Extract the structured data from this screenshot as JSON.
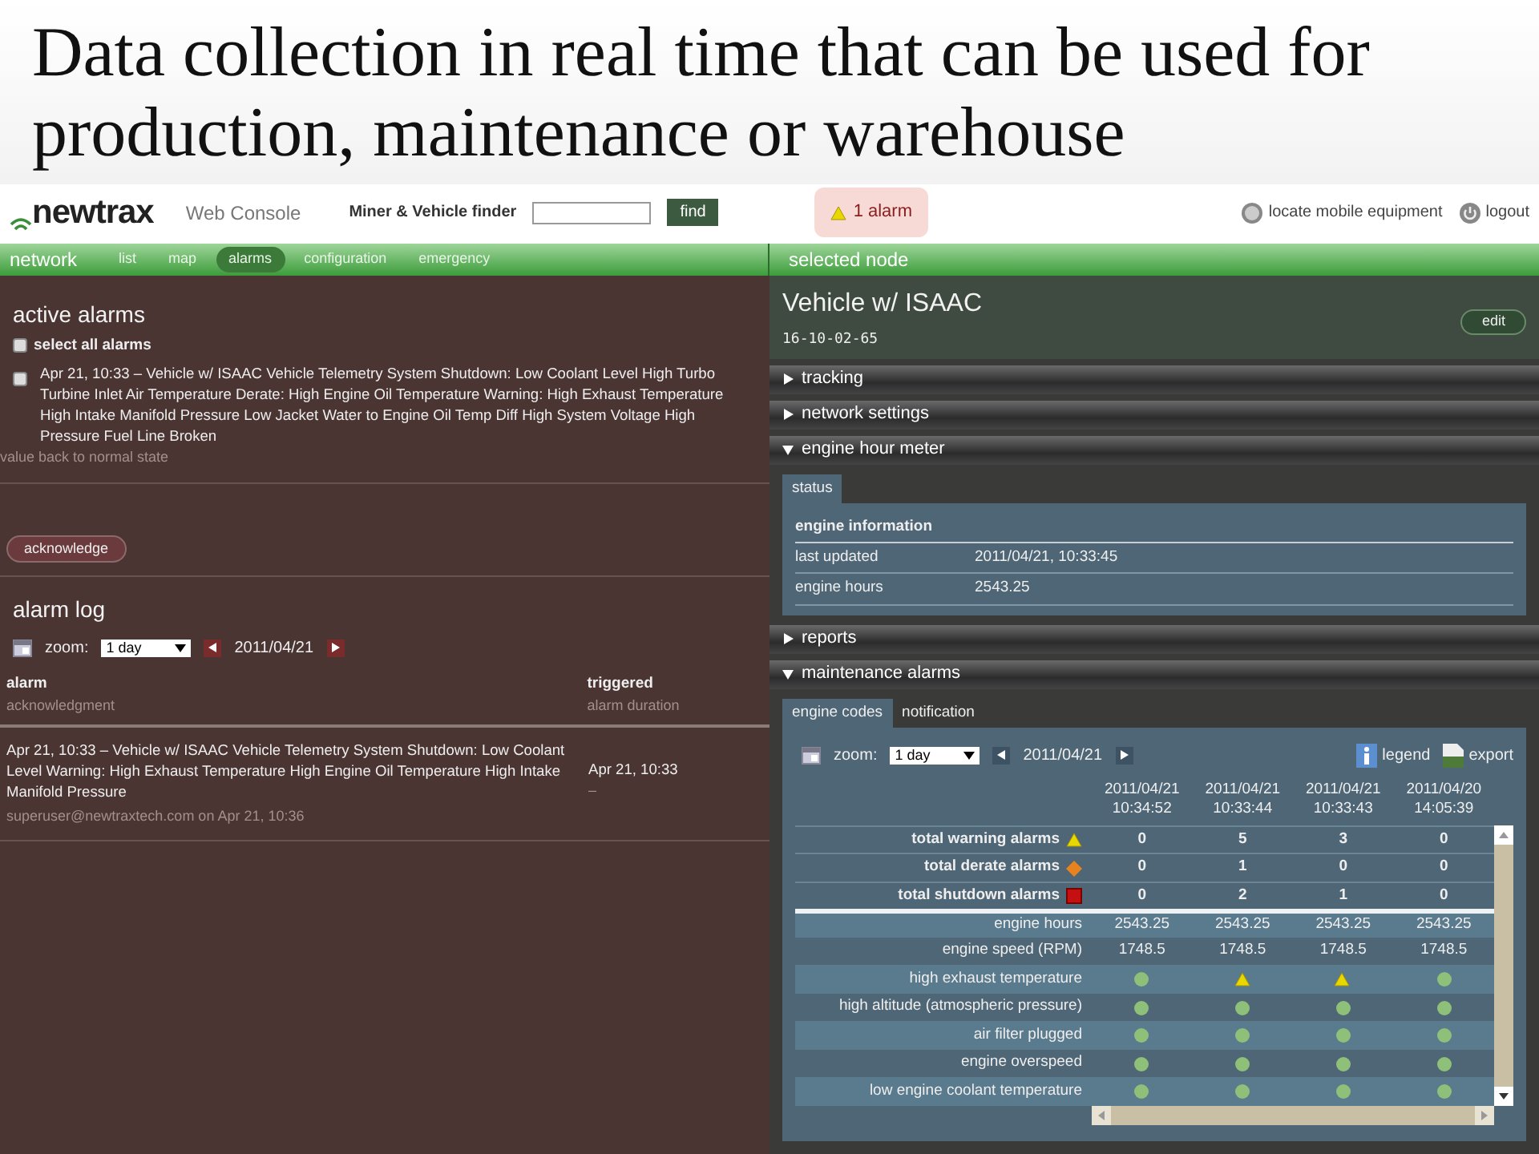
{
  "slide_title": "Data collection in real time that can be used for production, maintenance or warehouse",
  "header": {
    "logo": "newtrax",
    "app_name": "Web Console",
    "finder_label": "Miner & Vehicle finder",
    "find_button": "find",
    "alarm_badge": "1 alarm",
    "links": [
      {
        "label": "locate mobile equipment",
        "kind": "locate"
      },
      {
        "label": "logout",
        "kind": "logout"
      }
    ]
  },
  "nav": {
    "title": "network",
    "items": [
      {
        "label": "list",
        "selected": false
      },
      {
        "label": "map",
        "selected": false
      },
      {
        "label": "alarms",
        "selected": true
      },
      {
        "label": "configuration",
        "selected": false
      },
      {
        "label": "emergency",
        "selected": false
      }
    ],
    "right_title": "selected node"
  },
  "active_alarms": {
    "title": "active alarms",
    "select_all": {
      "label": "select all alarms",
      "checked": false
    },
    "alarms": [
      {
        "text": "Apr 21, 10:33 – Vehicle w/ ISAAC Vehicle Telemetry System Shutdown: Low Coolant Level High Turbo Turbine Inlet Air Temperature Derate: High Engine Oil Temperature Warning: High Exhaust Temperature High Intake Manifold Pressure Low Jacket Water to Engine Oil Temp Diff High System Voltage High Pressure Fuel Line Broken",
        "checked": false
      }
    ],
    "hint": "value back to normal state",
    "button": "acknowledge"
  },
  "alarm_log": {
    "title": "alarm log",
    "zoom_label": "zoom:",
    "zoom_value": "1 day",
    "date": "2011/04/21",
    "columns": [
      {
        "title": "alarm",
        "subtitle": "acknowledgment"
      },
      {
        "title": "triggered",
        "subtitle": "alarm duration"
      }
    ],
    "rows": [
      {
        "alarm": "Apr 21, 10:33 – Vehicle w/ ISAAC Vehicle Telemetry System Shutdown: Low Coolant Level Warning: High Exhaust Temperature High Engine Oil Temperature High Intake Manifold Pressure",
        "acknowledgment": "superuser@newtraxtech.com on Apr 21, 10:36",
        "triggered": "Apr 21, 10:33",
        "duration": "–"
      }
    ]
  },
  "node": {
    "title": "Vehicle w/ ISAAC",
    "id": "16-10-02-65",
    "edit_button": "edit",
    "sections": [
      {
        "label": "tracking",
        "expanded": false
      },
      {
        "label": "network settings",
        "expanded": false
      },
      {
        "label": "engine hour meter",
        "expanded": true,
        "content": {
          "kind": "info",
          "tabs": [
            {
              "label": "status",
              "selected": true
            }
          ],
          "heading": "engine information",
          "rows": [
            {
              "label": "last updated",
              "value": "2011/04/21, 10:33:45"
            },
            {
              "label": "engine hours",
              "value": "2543.25"
            }
          ]
        }
      },
      {
        "label": "reports",
        "expanded": false
      },
      {
        "label": "maintenance alarms",
        "expanded": true,
        "content": {
          "kind": "grid",
          "tabs": [
            {
              "label": "engine codes",
              "selected": true
            },
            {
              "label": "notification",
              "selected": false
            }
          ],
          "zoom_label": "zoom:",
          "zoom_value": "1 day",
          "date": "2011/04/21",
          "legend": "legend",
          "export": "export",
          "columns": [
            {
              "date": "2011/04/21",
              "time": "10:34:52"
            },
            {
              "date": "2011/04/21",
              "time": "10:33:44"
            },
            {
              "date": "2011/04/21",
              "time": "10:33:43"
            },
            {
              "date": "2011/04/20",
              "time": "14:05:39"
            }
          ],
          "summary": [
            {
              "label": "total warning alarms",
              "kind": "warning",
              "values": [
                "0",
                "5",
                "3",
                "0"
              ]
            },
            {
              "label": "total derate alarms",
              "kind": "derate",
              "values": [
                "0",
                "1",
                "0",
                "0"
              ]
            },
            {
              "label": "total shutdown alarms",
              "kind": "shutdown",
              "values": [
                "0",
                "2",
                "1",
                "0"
              ]
            }
          ],
          "rows": [
            {
              "label": "engine hours",
              "kind": "value",
              "values": [
                "2543.25",
                "2543.25",
                "2543.25",
                "2543.25"
              ]
            },
            {
              "label": "engine speed (RPM)",
              "kind": "value",
              "values": [
                "1748.5",
                "1748.5",
                "1748.5",
                "1748.5"
              ]
            },
            {
              "label": "high exhaust temperature",
              "kind": "status",
              "warnings": [
                false,
                true,
                true,
                false
              ]
            },
            {
              "label": "high altitude (atmospheric pressure)",
              "kind": "status",
              "warnings": [
                false,
                false,
                false,
                false
              ]
            },
            {
              "label": "air filter plugged",
              "kind": "status",
              "warnings": [
                false,
                false,
                false,
                false
              ]
            },
            {
              "label": "engine overspeed",
              "kind": "status",
              "warnings": [
                false,
                false,
                false,
                false
              ]
            },
            {
              "label": "low engine coolant temperature",
              "kind": "status",
              "warnings": [
                false,
                false,
                false,
                false
              ]
            }
          ]
        }
      }
    ]
  }
}
